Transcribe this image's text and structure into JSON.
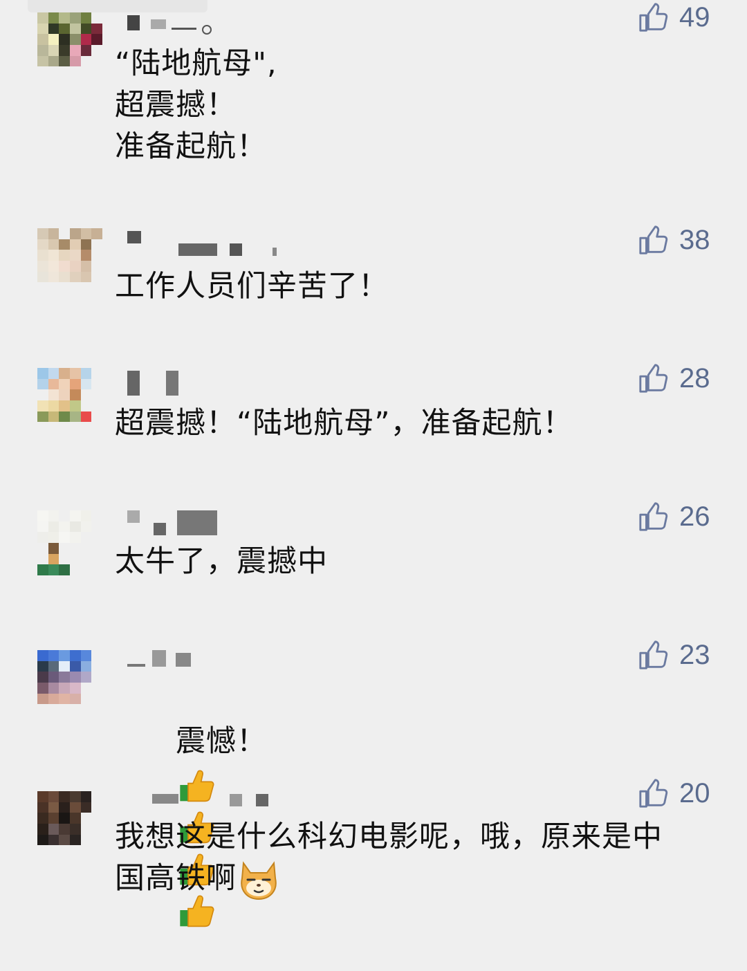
{
  "comments": [
    {
      "nickname": "",
      "lines": [
        "“陆地航母\",",
        "超震撼！",
        "准备起航！"
      ],
      "likes": "49"
    },
    {
      "nickname": "",
      "lines": [
        "工作人员们辛苦了！"
      ],
      "likes": "38"
    },
    {
      "nickname": "",
      "lines": [
        "超震撼！“陆地航母”，准备起航！"
      ],
      "likes": "28"
    },
    {
      "nickname": "",
      "lines": [
        "太牛了，震撼中"
      ],
      "likes": "26"
    },
    {
      "nickname": "",
      "lines": [
        "震憾！"
      ],
      "emoji": [
        "thumbs-up-emoji",
        "thumbs-up-emoji",
        "thumbs-up-emoji",
        "thumbs-up-emoji"
      ],
      "likes": "23"
    },
    {
      "nickname": "",
      "lines": [
        "我想这是什么科幻电影呢，哦，原来是中",
        "国高铁啊"
      ],
      "emoji": [
        "smug-dog-emoji"
      ],
      "likes": "20"
    }
  ],
  "icons": {
    "like": "thumbs-up-outline-icon"
  },
  "colors": {
    "background": "#efefef",
    "like_icon": "#6b7aa0",
    "text": "#111111"
  }
}
